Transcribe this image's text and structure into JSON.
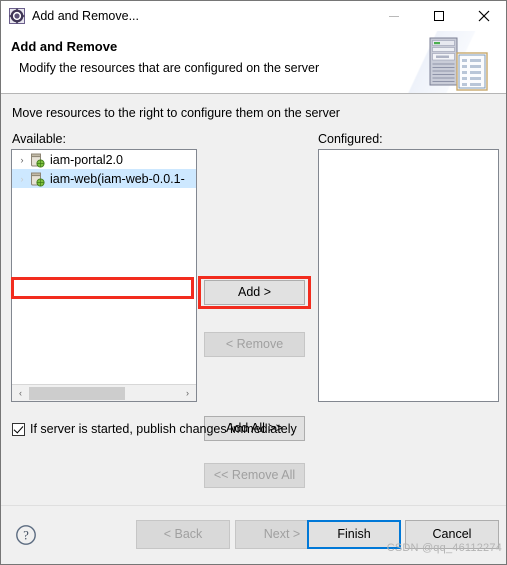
{
  "window": {
    "title": "Add and Remove...",
    "icon": "eclipse-server-gear-icon",
    "minimize_label": "—",
    "maximize_label": "□",
    "close_label": "✕"
  },
  "banner": {
    "title": "Add and Remove",
    "description": "Modify the resources that are configured on the server",
    "art": "server-and-document-icon"
  },
  "main": {
    "instruction": "Move resources to the right to configure them on the server",
    "available_label": "Available:",
    "configured_label": "Configured:",
    "available_items": [
      {
        "label": "iam-portal2.0",
        "twisty": "›",
        "selected": false,
        "icon": "web-module-icon"
      },
      {
        "label": "iam-web(iam-web-0.0.1-",
        "twisty": "›",
        "selected": true,
        "icon": "web-module-icon"
      }
    ],
    "configured_items": [],
    "scrollbar": {
      "left_arrow": "‹",
      "right_arrow": "›"
    }
  },
  "transfer_buttons": {
    "add": {
      "label": "Add >",
      "enabled": true,
      "highlighted": true
    },
    "remove": {
      "label": "< Remove",
      "enabled": false,
      "highlighted": false
    },
    "add_all": {
      "label": "Add All >>",
      "enabled": true,
      "highlighted": false
    },
    "remove_all": {
      "label": "<< Remove All",
      "enabled": false,
      "highlighted": false
    }
  },
  "publish_option": {
    "label": "If server is started, publish changes immediately",
    "checked": true
  },
  "footer": {
    "help_label": "?",
    "back": {
      "label": "< Back",
      "enabled": false
    },
    "next": {
      "label": "Next >",
      "enabled": false
    },
    "finish": {
      "label": "Finish",
      "enabled": true,
      "default": true
    },
    "cancel": {
      "label": "Cancel",
      "enabled": true
    },
    "watermark": "CSDN @qq_46112274"
  },
  "colors": {
    "accent_blue": "#0078d7",
    "annotation_red": "#f22c1e",
    "selection_blue": "#cde8ff",
    "dialog_gray": "#f0f0f0",
    "button_gray": "#e1e1e1"
  }
}
